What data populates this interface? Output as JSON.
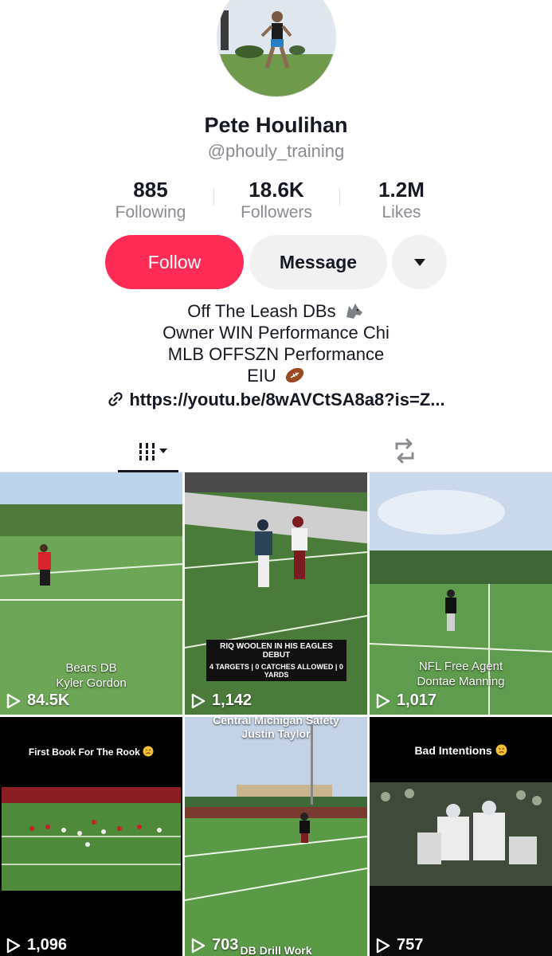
{
  "profile": {
    "name": "Pete Houlihan",
    "handle": "@phouly_training",
    "stats": [
      {
        "value": "885",
        "label": "Following"
      },
      {
        "value": "18.6K",
        "label": "Followers"
      },
      {
        "value": "1.2M",
        "label": "Likes"
      }
    ]
  },
  "actions": {
    "follow_label": "Follow",
    "message_label": "Message"
  },
  "bio": {
    "lines": [
      "Off The Leash DBs",
      "Owner WIN Performance Chi",
      "MLB OFFSZN Performance",
      "EIU"
    ],
    "emoji": [
      "wolf-emoji",
      "football-emoji"
    ],
    "link": "https://youtu.be/8wAVCtSA8a8?is=Z..."
  },
  "tabs": {
    "videos_icon": "grid-icon",
    "reposts_icon": "repost-icon"
  },
  "colors": {
    "accent": "#fe2c55",
    "secondary_button": "#f1f1f2",
    "muted_text": "#8a8b91"
  },
  "videos": [
    {
      "views": "84.5K",
      "caption_lines": [
        "Bears DB",
        "Kyler Gordon"
      ]
    },
    {
      "views": "1,142",
      "banner_title": "RIQ WOOLEN IN HIS EAGLES DEBUT",
      "banner_sub": "4 TARGETS | 0 CATCHES ALLOWED | 0 YARDS"
    },
    {
      "views": "1,017",
      "caption_lines": [
        "NFL Free Agent",
        "Dontae Manning"
      ]
    },
    {
      "views": "1,096",
      "caption_top": "First Book For The Rook"
    },
    {
      "views": "703",
      "caption_top_lines": [
        "Central Michigan Safety",
        "Justin Taylor"
      ],
      "caption_bottom": "DB Drill Work"
    },
    {
      "views": "757",
      "caption_top": "Bad Intentions"
    }
  ]
}
